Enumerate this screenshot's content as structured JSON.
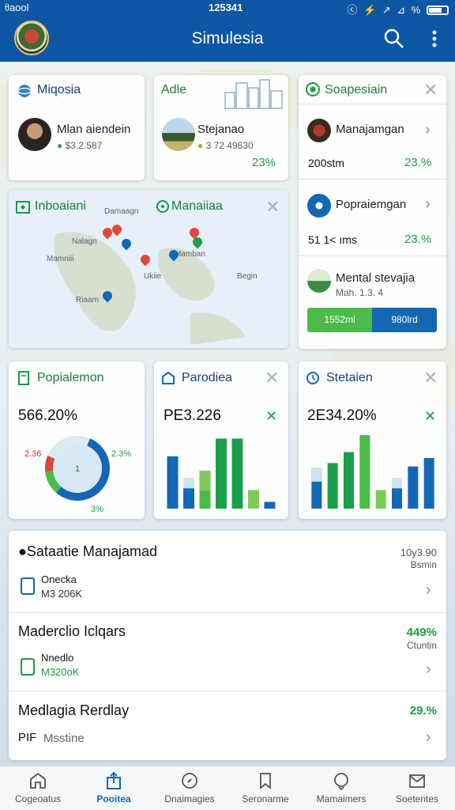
{
  "status_bar": {
    "carrier": "ᦲaool",
    "time": "125341",
    "signal_icons": "ⓒ ⚡ ↗ ⊿ %"
  },
  "app_bar": {
    "title": "Simulesia",
    "search_icon": "search-icon",
    "menu_icon": "more-vertical-icon"
  },
  "top_left_card": {
    "title": "Miqosia",
    "person": {
      "name": "Mlan aiendein",
      "value": "$3.2.587"
    }
  },
  "top_mid_card": {
    "title": "Adle",
    "person": {
      "name": "Stejanao",
      "value": "3 72 49630"
    },
    "pct": "23%"
  },
  "right_panel": {
    "title": "Soapesiain",
    "items": [
      {
        "name": "Manajamgan",
        "value": "200stm",
        "pct": "23.%"
      },
      {
        "name": "Popraiemgan",
        "value": "51 1< ıms",
        "pct": "23.%"
      }
    ],
    "featured": {
      "name": "Mental stevajia",
      "sub": "Mah. 1.3. 4"
    },
    "split_bar": {
      "left_label": "1552ml",
      "right_label": "980lrd",
      "left_fraction": 0.5
    }
  },
  "map_card": {
    "tab_left": "Inboaiani",
    "tab_right": "Manaiiaa",
    "labels": [
      "Damaagn",
      "Mamniii",
      "Begin",
      "Riaam",
      "Ukiie",
      "Nalagn",
      "Mamban"
    ]
  },
  "stat_cards": [
    {
      "title": "Popialemon",
      "value": "566.20%",
      "legend_left": "2.36",
      "legend_right": "2.3%",
      "legend_bottom": "3%",
      "center": "1"
    },
    {
      "title": "Parodiea",
      "value": "PE3.226"
    },
    {
      "title": "Stetaien",
      "value": "2E34.20%"
    }
  ],
  "chart_data": [
    {
      "type": "pie",
      "slices": [
        55,
        12,
        8,
        25
      ],
      "colors": [
        "#1467b4",
        "#4cbb47",
        "#d9463b",
        "#dce9f3"
      ]
    },
    {
      "type": "bar",
      "values": [
        6.2,
        3.6,
        4.5,
        8.3,
        8.3,
        2.2,
        0.8
      ],
      "colors": [
        "#1467b4",
        "#1467b4",
        "#4cbb47",
        "#1aa04b",
        "#1aa04b",
        "#7ecb5c",
        "#1467b4"
      ],
      "stack": [
        0,
        1.2,
        2.4,
        0,
        0,
        0,
        0
      ]
    },
    {
      "type": "bar",
      "values": [
        4.8,
        5.4,
        6.7,
        8.7,
        2.2,
        3.6,
        5.0,
        6.0
      ],
      "colors": [
        "#1467b4",
        "#1aa04b",
        "#1aa04b",
        "#4cbb47",
        "#7ecb5c",
        "#1467b4",
        "#1467b4",
        "#1467b4"
      ],
      "stack": [
        1.6,
        0,
        0,
        0,
        0,
        1.2,
        0,
        0
      ]
    }
  ],
  "list": [
    {
      "title": "Sataatie Manajamad",
      "meta1": "10y3.90",
      "meta2": "Bsmin",
      "sub_title": "Onecka",
      "sub_value": "M3 206K"
    },
    {
      "title": "Maderclio Iclqars",
      "pct": "449%",
      "meta2": "Ctuntin",
      "sub_title": "Nnedlo",
      "sub_value": "M320oK"
    },
    {
      "title": "Medlagia Rerdlay",
      "pct": "29.%",
      "sub_title": "PIF",
      "sub_value": "Msstine"
    }
  ],
  "bottom_nav": [
    {
      "label": "Cogeoatus",
      "icon": "home-icon"
    },
    {
      "label": "Pooitea",
      "icon": "share-icon"
    },
    {
      "label": "Dnaimagies",
      "icon": "compass-icon"
    },
    {
      "label": "Seronarme",
      "icon": "bookmark-icon"
    },
    {
      "label": "Mamaimers",
      "icon": "chat-icon"
    },
    {
      "label": "Soetentes",
      "icon": "mail-icon"
    }
  ]
}
